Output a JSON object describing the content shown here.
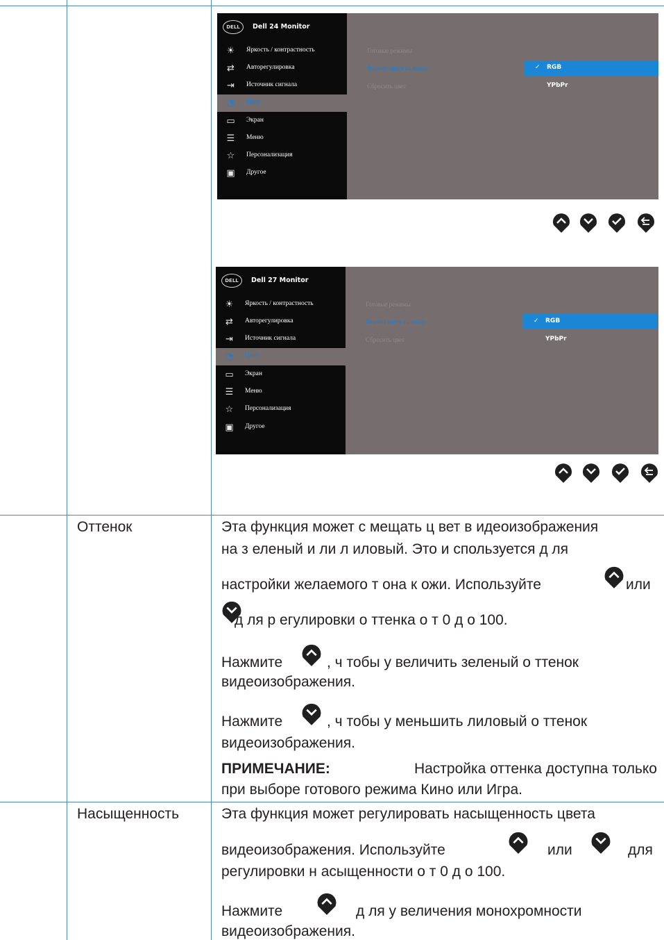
{
  "osd_panels": [
    {
      "title": "Dell 24 Monitor",
      "logo": "DELL",
      "menu": [
        {
          "icon": "brightness-icon",
          "glyph": "☀",
          "label": "Яркость / контрастность"
        },
        {
          "icon": "auto-adjust-icon",
          "glyph": "⇄",
          "label": "Авторегулировка"
        },
        {
          "icon": "input-source-icon",
          "glyph": "⇥",
          "label": "Источник сигнала"
        },
        {
          "icon": "color-icon",
          "glyph": "◔",
          "label": "Цвет",
          "selected": true
        },
        {
          "icon": "display-icon",
          "glyph": "▭",
          "label": "Экран"
        },
        {
          "icon": "menu-icon",
          "glyph": "☰",
          "label": "Меню"
        },
        {
          "icon": "star-icon",
          "glyph": "☆",
          "label": "Персонализация"
        },
        {
          "icon": "other-icon",
          "glyph": "▣",
          "label": "Другое"
        }
      ],
      "submenu": [
        "Готовые режимы",
        "Формат цвета на входе",
        "Сбросить цвет"
      ],
      "options": [
        "RGB",
        "YPbPr"
      ],
      "selected_option": "RGB",
      "checkmark": "✓"
    },
    {
      "title": "Dell 27 Monitor",
      "logo": "DELL",
      "menu": [
        {
          "icon": "brightness-icon",
          "glyph": "☀",
          "label": "Яркость / контрастность"
        },
        {
          "icon": "auto-adjust-icon",
          "glyph": "⇄",
          "label": "Авторегулировка"
        },
        {
          "icon": "input-source-icon",
          "glyph": "⇥",
          "label": "Источник сигнала"
        },
        {
          "icon": "color-icon",
          "glyph": "◔",
          "label": "Цвет",
          "selected": true
        },
        {
          "icon": "display-icon",
          "glyph": "▭",
          "label": "Экран"
        },
        {
          "icon": "menu-icon",
          "glyph": "☰",
          "label": "Меню"
        },
        {
          "icon": "star-icon",
          "glyph": "☆",
          "label": "Персонализация"
        },
        {
          "icon": "other-icon",
          "glyph": "▣",
          "label": "Другое"
        }
      ],
      "submenu": [
        "Готовые режимы",
        "Формат цвета на входе",
        "Сбросить цвет"
      ],
      "options": [
        "RGB",
        "YPbPr"
      ],
      "selected_option": "RGB",
      "checkmark": "✓"
    }
  ],
  "joystick_buttons": [
    "up-button-icon",
    "down-button-icon",
    "ok-button-icon",
    "back-button-icon"
  ],
  "rows": {
    "hue": {
      "name": "Оттенок",
      "lines": [
        "Эта функция может с мещать ц вет в идеоизображения",
        "на з еленый и ли л иловый. Это и спользуется д ля",
        "настройки желаемого т она к ожи. Используйте",
        "или",
        "д ля р егулировки о ттенка о т 0 д о 100.",
        "Нажмите",
        ", ч тобы у величить зеленый о ттенок",
        "видеоизображения.",
        "Нажмите",
        ", ч тобы у меньшить лиловый о ттенок",
        "видеоизображения."
      ],
      "note_label": "ПРИМЕЧАНИЕ:",
      "note_text_1": "Настройка оттенка доступна только",
      "note_text_2": "при выборе готового режима Кино или Игра."
    },
    "saturation": {
      "name": "Насыщенность",
      "lines": [
        "Эта функция может регулировать насыщенность цвета",
        "видеоизображения. Используйте",
        "или",
        "для",
        "регулировки н асыщенности о т 0 д о 100.",
        "Нажмите",
        "д ля у величения монохромности",
        "видеоизображения."
      ]
    }
  }
}
